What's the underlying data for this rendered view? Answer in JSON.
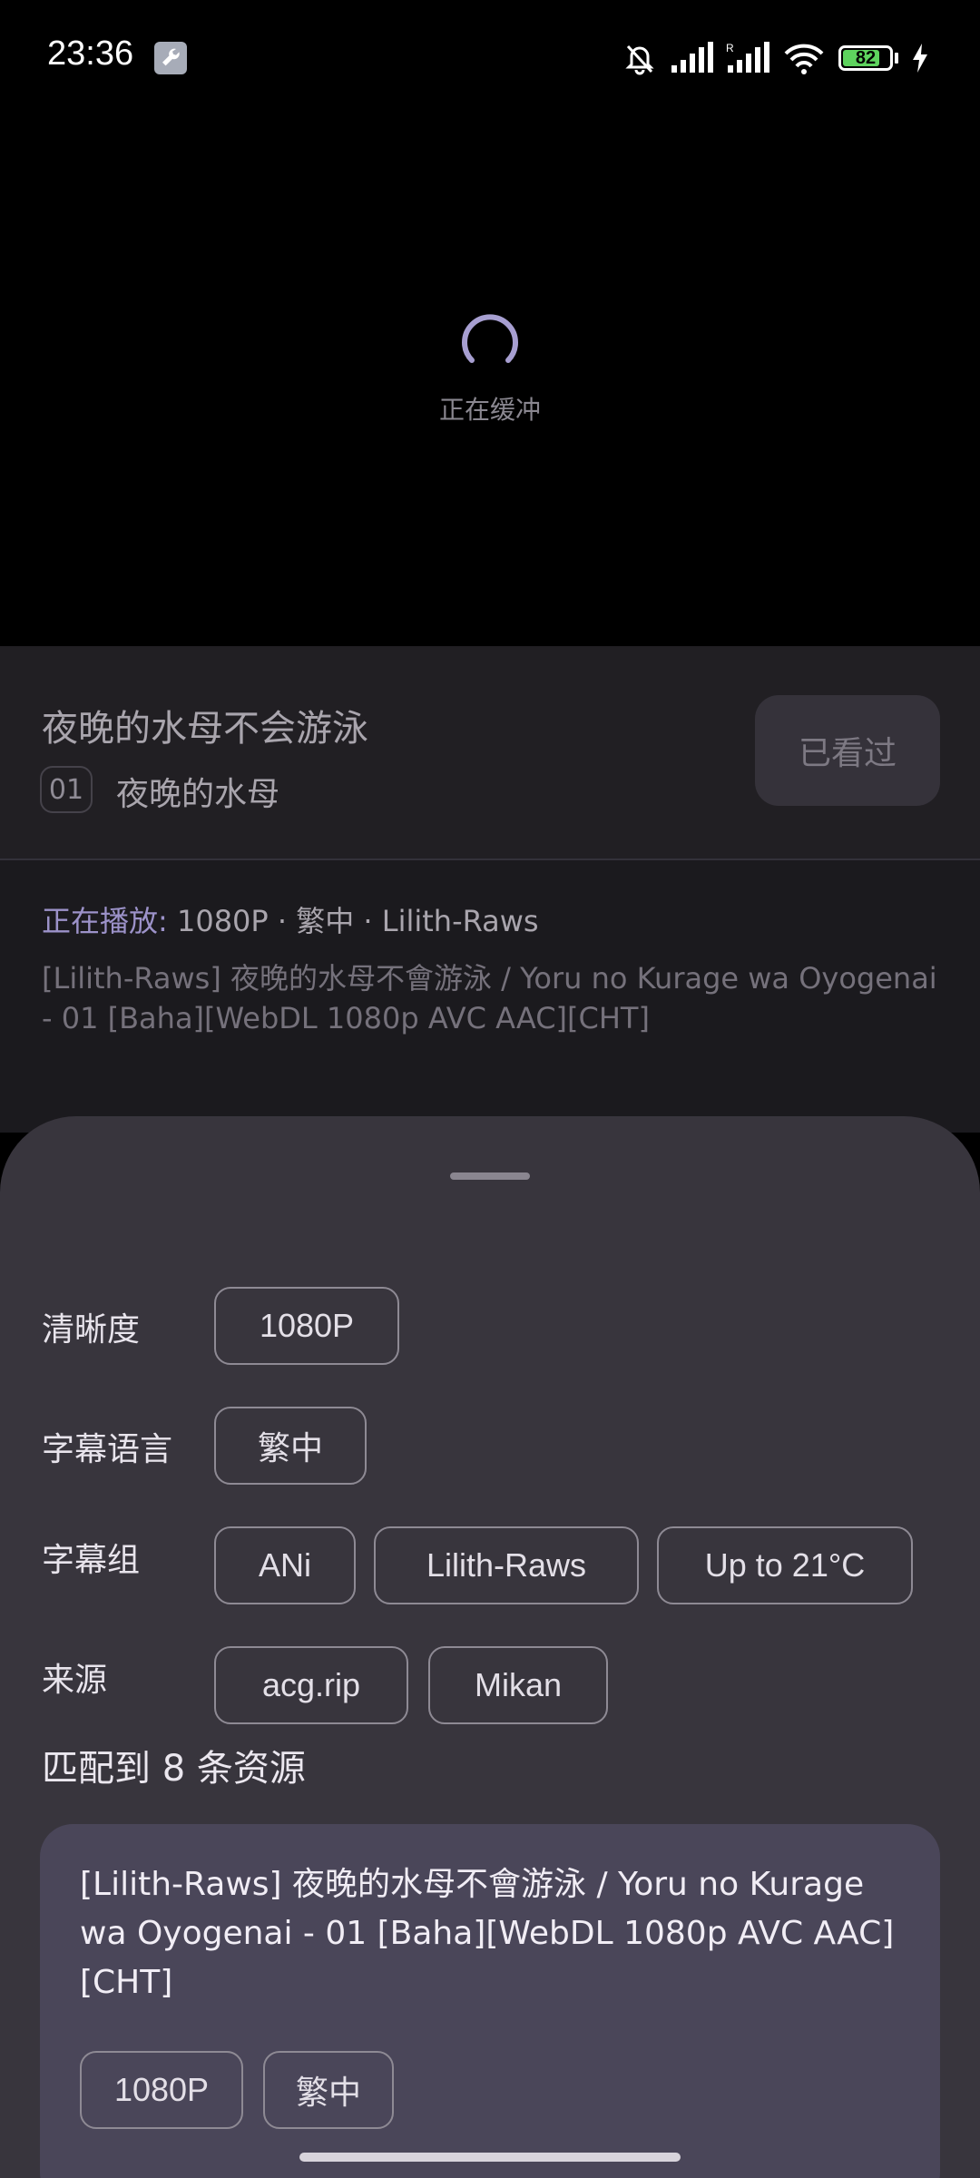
{
  "status_bar": {
    "time": "23:36",
    "battery": "82",
    "battery_level": 0.82
  },
  "video": {
    "buffering_text": "正在缓冲"
  },
  "episode": {
    "anime_title": "夜晚的水母不会游泳",
    "episode_number": "01",
    "episode_title": "夜晚的水母",
    "watched_label": "已看过"
  },
  "now_playing": {
    "label": "正在播放:",
    "info": "1080P · 繁中 · Lilith-Raws",
    "file_name": "[Lilith-Raws] 夜晚的水母不會游泳 / Yoru no Kurage wa Oyogenai - 01 [Baha][WebDL 1080p AVC AAC][CHT]"
  },
  "filters": {
    "resolution": {
      "label": "清晰度",
      "options": [
        "1080P"
      ]
    },
    "subtitle_language": {
      "label": "字幕语言",
      "options": [
        "繁中"
      ]
    },
    "subtitle_group": {
      "label": "字幕组",
      "options": [
        "ANi",
        "Lilith-Raws",
        "Up to 21°C"
      ]
    },
    "source": {
      "label": "来源",
      "options": [
        "acg.rip",
        "Mikan"
      ]
    }
  },
  "results": {
    "count_text": "匹配到 8 条资源",
    "items": [
      {
        "title": "[Lilith-Raws] 夜晚的水母不會游泳 / Yoru no Kurage wa Oyogenai - 01 [Baha][WebDL 1080p AVC AAC][CHT]",
        "tags": [
          "1080P",
          "繁中"
        ]
      }
    ]
  }
}
